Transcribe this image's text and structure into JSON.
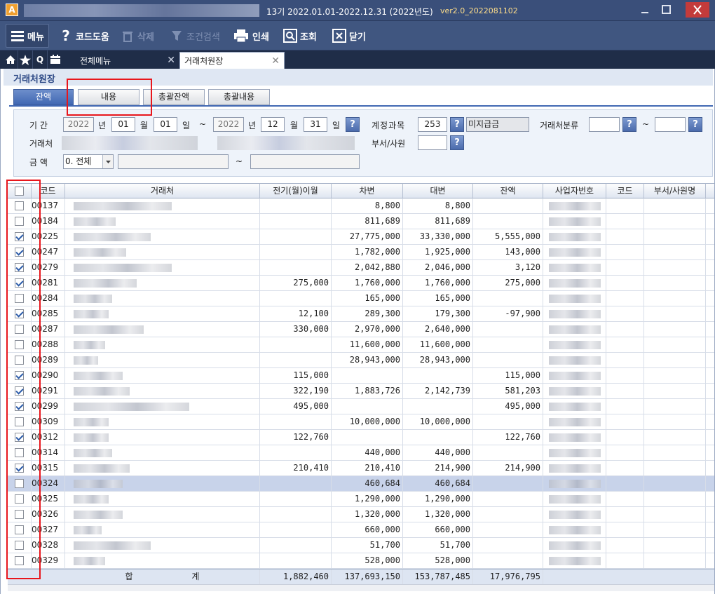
{
  "titlebar": {
    "app_icon": "A",
    "period": "13기  2022.01.01-2022.12.31  (2022년도)",
    "version": "ver2.0_2022081102"
  },
  "toolbar": {
    "menu": "메뉴",
    "help": "코드도움",
    "delete": "삭제",
    "filter": "조건검색",
    "print": "인쇄",
    "search": "조회",
    "close": "닫기"
  },
  "tabs": {
    "all_menu": "전체메뉴",
    "ledger": "거래처원장",
    "close_glyph": "✕"
  },
  "screen": {
    "title": "거래처원장",
    "subtabs": [
      "잔액",
      "내용",
      "총괄잔액",
      "총괄내용"
    ]
  },
  "filter": {
    "period_label": "기  간",
    "from_year": "2022",
    "year_unit": "년",
    "from_month": "01",
    "month_unit": "월",
    "from_day": "01",
    "day_unit": "일",
    "tilde": "~",
    "to_year": "2022",
    "to_month": "12",
    "to_day": "31",
    "account_label": "계정과목",
    "account_code": "253",
    "account_name": "미지급금",
    "partner_class_label": "거래처분류",
    "partner_label": "거래처",
    "dept_label": "부서/사원",
    "amount_label": "금  액",
    "amount_option": "0. 전체",
    "help_glyph": "?"
  },
  "grid": {
    "headers": [
      "",
      "코드",
      "거래처",
      "전기(월)이월",
      "차변",
      "대변",
      "잔액",
      "사업자번호",
      "코드",
      "부서/사원명"
    ],
    "rows": [
      {
        "checked": false,
        "code": "00137",
        "prev": "",
        "debit": "8,800",
        "credit": "8,800",
        "balance": "",
        "blur_w": 140
      },
      {
        "checked": false,
        "code": "00184",
        "prev": "",
        "debit": "811,689",
        "credit": "811,689",
        "balance": "",
        "blur_w": 60
      },
      {
        "checked": true,
        "code": "00225",
        "prev": "",
        "debit": "27,775,000",
        "credit": "33,330,000",
        "balance": "5,555,000",
        "blur_w": 110
      },
      {
        "checked": true,
        "code": "00247",
        "prev": "",
        "debit": "1,782,000",
        "credit": "1,925,000",
        "balance": "143,000",
        "blur_w": 75
      },
      {
        "checked": true,
        "code": "00279",
        "prev": "",
        "debit": "2,042,880",
        "credit": "2,046,000",
        "balance": "3,120",
        "blur_w": 140
      },
      {
        "checked": true,
        "code": "00281",
        "prev": "275,000",
        "debit": "1,760,000",
        "credit": "1,760,000",
        "balance": "275,000",
        "blur_w": 90
      },
      {
        "checked": false,
        "code": "00284",
        "prev": "",
        "debit": "165,000",
        "credit": "165,000",
        "balance": "",
        "blur_w": 55
      },
      {
        "checked": true,
        "code": "00285",
        "prev": "12,100",
        "debit": "289,300",
        "credit": "179,300",
        "balance": "-97,900",
        "blur_w": 50
      },
      {
        "checked": false,
        "code": "00287",
        "prev": "330,000",
        "debit": "2,970,000",
        "credit": "2,640,000",
        "balance": "",
        "blur_w": 100
      },
      {
        "checked": false,
        "code": "00288",
        "prev": "",
        "debit": "11,600,000",
        "credit": "11,600,000",
        "balance": "",
        "blur_w": 45
      },
      {
        "checked": false,
        "code": "00289",
        "prev": "",
        "debit": "28,943,000",
        "credit": "28,943,000",
        "balance": "",
        "blur_w": 35
      },
      {
        "checked": true,
        "code": "00290",
        "prev": "115,000",
        "debit": "",
        "credit": "",
        "balance": "115,000",
        "blur_w": 70
      },
      {
        "checked": true,
        "code": "00291",
        "prev": "322,190",
        "debit": "1,883,726",
        "credit": "2,142,739",
        "balance": "581,203",
        "blur_w": 80
      },
      {
        "checked": true,
        "code": "00299",
        "prev": "495,000",
        "debit": "",
        "credit": "",
        "balance": "495,000",
        "blur_w": 165
      },
      {
        "checked": false,
        "code": "00309",
        "prev": "",
        "debit": "10,000,000",
        "credit": "10,000,000",
        "balance": "",
        "blur_w": 50
      },
      {
        "checked": true,
        "code": "00312",
        "prev": "122,760",
        "debit": "",
        "credit": "",
        "balance": "122,760",
        "blur_w": 50
      },
      {
        "checked": false,
        "code": "00314",
        "prev": "",
        "debit": "440,000",
        "credit": "440,000",
        "balance": "",
        "blur_w": 55
      },
      {
        "checked": true,
        "code": "00315",
        "prev": "210,410",
        "debit": "210,410",
        "credit": "214,900",
        "balance": "214,900",
        "blur_w": 80
      },
      {
        "checked": false,
        "code": "00324",
        "prev": "",
        "debit": "460,684",
        "credit": "460,684",
        "balance": "",
        "blur_w": 70,
        "selected": true
      },
      {
        "checked": false,
        "code": "00325",
        "prev": "",
        "debit": "1,290,000",
        "credit": "1,290,000",
        "balance": "",
        "blur_w": 50
      },
      {
        "checked": false,
        "code": "00326",
        "prev": "",
        "debit": "1,320,000",
        "credit": "1,320,000",
        "balance": "",
        "blur_w": 70
      },
      {
        "checked": false,
        "code": "00327",
        "prev": "",
        "debit": "660,000",
        "credit": "660,000",
        "balance": "",
        "blur_w": 40
      },
      {
        "checked": false,
        "code": "00328",
        "prev": "",
        "debit": "51,700",
        "credit": "51,700",
        "balance": "",
        "blur_w": 110
      },
      {
        "checked": false,
        "code": "00329",
        "prev": "",
        "debit": "528,000",
        "credit": "528,000",
        "balance": "",
        "blur_w": 45
      }
    ],
    "total": {
      "label_left": "합",
      "label_right": "계",
      "prev": "1,882,460",
      "debit": "137,693,150",
      "credit": "153,787,485",
      "balance": "17,976,795"
    }
  },
  "colors": {
    "accent": "#4168b3",
    "highlight": "#e8161c"
  }
}
